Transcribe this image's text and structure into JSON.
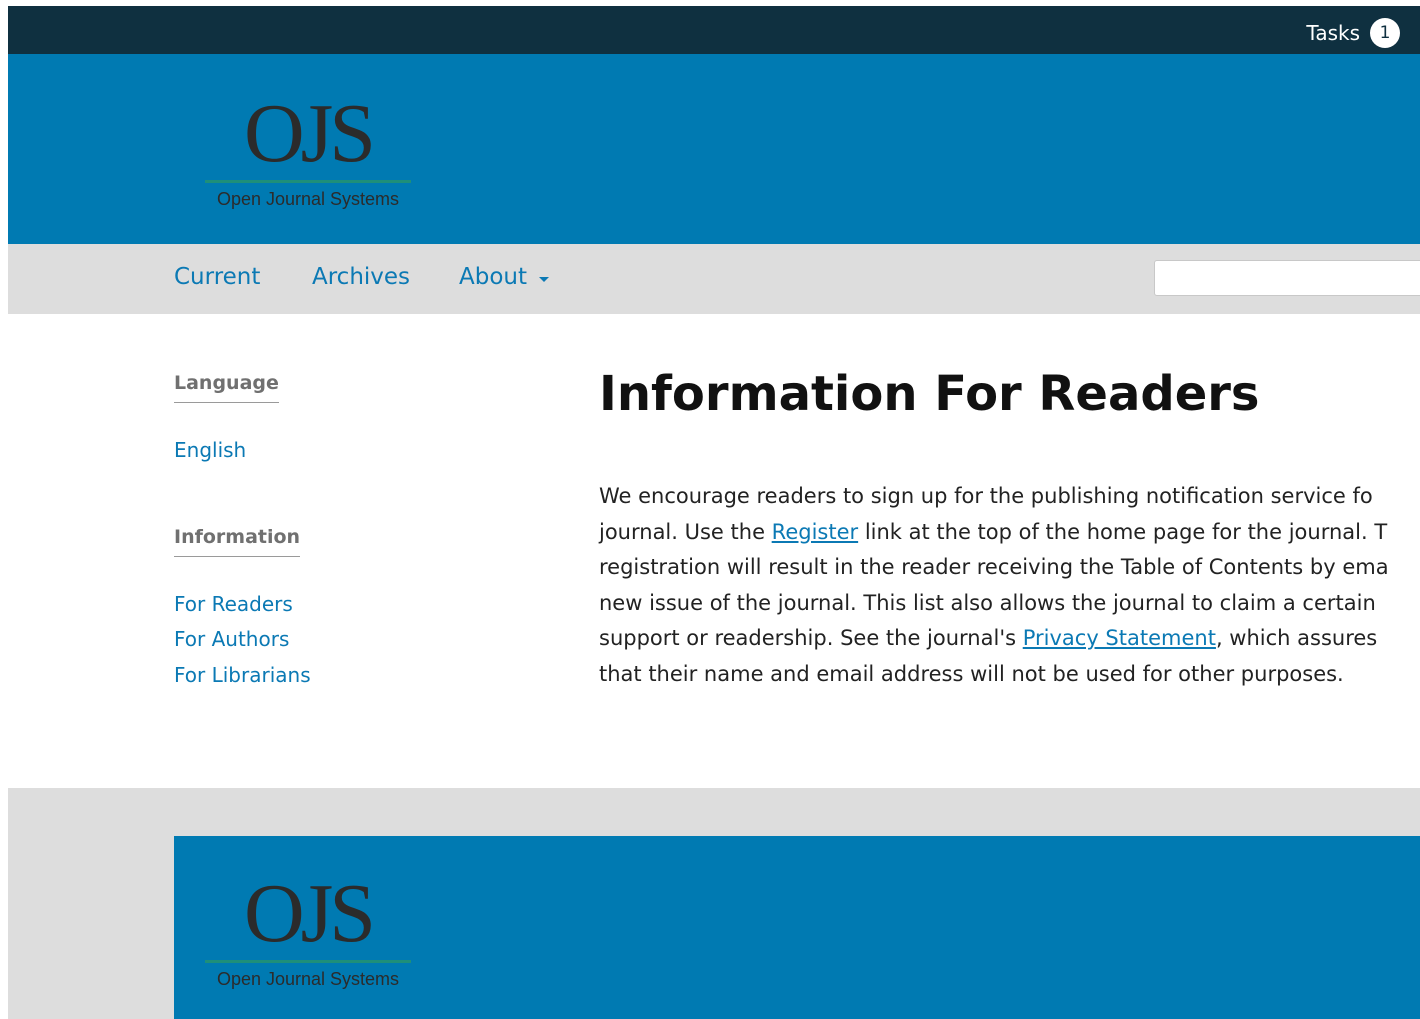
{
  "topbar": {
    "tasks_label": "Tasks",
    "tasks_count": "1"
  },
  "header": {
    "logo_mark": "OJS",
    "logo_subtitle": "Open Journal Systems"
  },
  "nav": {
    "items": [
      {
        "label": "Current"
      },
      {
        "label": "Archives"
      },
      {
        "label": "About"
      }
    ],
    "search_value": ""
  },
  "sidebar": {
    "language_heading": "Language",
    "language_link": "English",
    "information_heading": "Information",
    "information_links": [
      "For Readers",
      "For Authors",
      "For Librarians"
    ]
  },
  "main": {
    "title": "Information For Readers",
    "lines": [
      {
        "pre": "We encourage readers to sign up for the publishing notification service fo",
        "link": "",
        "post": ""
      },
      {
        "pre": "journal. Use the ",
        "link": "Register",
        "post": " link at the top of the home page for the journal. T"
      },
      {
        "pre": "registration will result in the reader receiving the Table of Contents by ema",
        "link": "",
        "post": ""
      },
      {
        "pre": "new issue of the journal. This list also allows the journal to claim a certain",
        "link": "",
        "post": ""
      },
      {
        "pre": "support or readership. See the journal's ",
        "link": "Privacy Statement",
        "post": ", which assures"
      },
      {
        "pre": "that their name and email address will not be used for other purposes.",
        "link": "",
        "post": ""
      }
    ]
  },
  "footer": {
    "logo_mark": "OJS",
    "logo_subtitle": "Open Journal Systems"
  },
  "colors": {
    "topbar": "#0f3040",
    "brand_blue": "#007ab2",
    "link": "#0b79b4",
    "nav_bg": "#dddddd"
  }
}
